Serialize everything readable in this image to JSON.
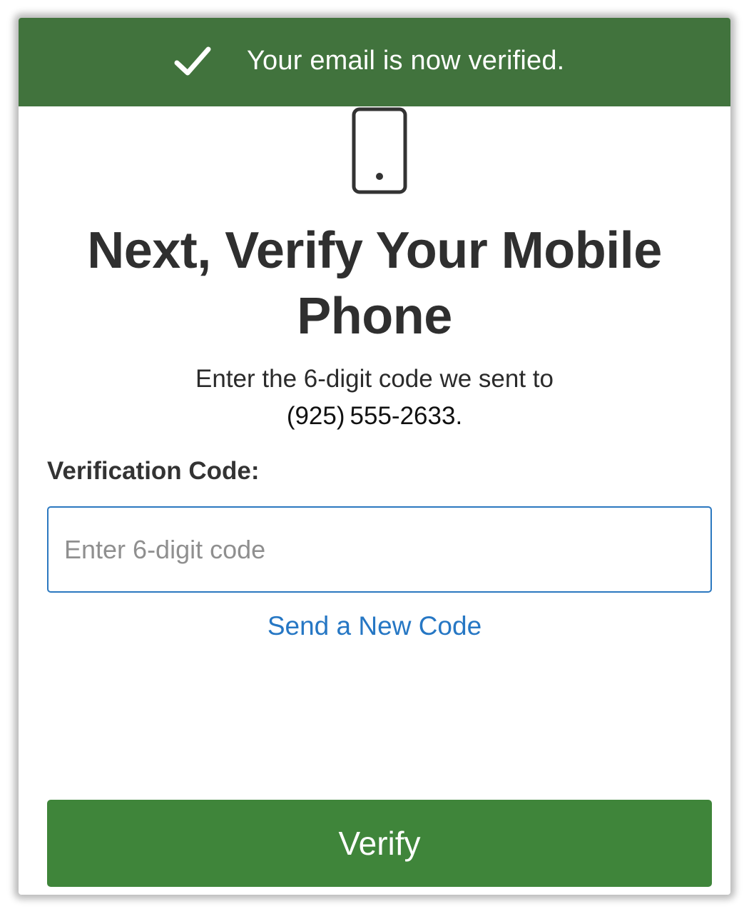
{
  "banner": {
    "icon": "checkmark-icon",
    "message": "Your email is now verified.",
    "color": "#41733d"
  },
  "hero_icon": "mobile-phone-icon",
  "title": "Next, Verify Your Mobile Phone",
  "instruction": {
    "text": "Enter the 6-digit code we sent to",
    "phone": "(925) 555-2633."
  },
  "form": {
    "label": "Verification Code:",
    "input_value": "",
    "placeholder": "Enter 6-digit code",
    "border_color": "#2b78c0"
  },
  "resend_link": {
    "label": "Send a New Code",
    "color": "#2677c4"
  },
  "verify_button": {
    "label": "Verify",
    "color": "#3f853a"
  }
}
